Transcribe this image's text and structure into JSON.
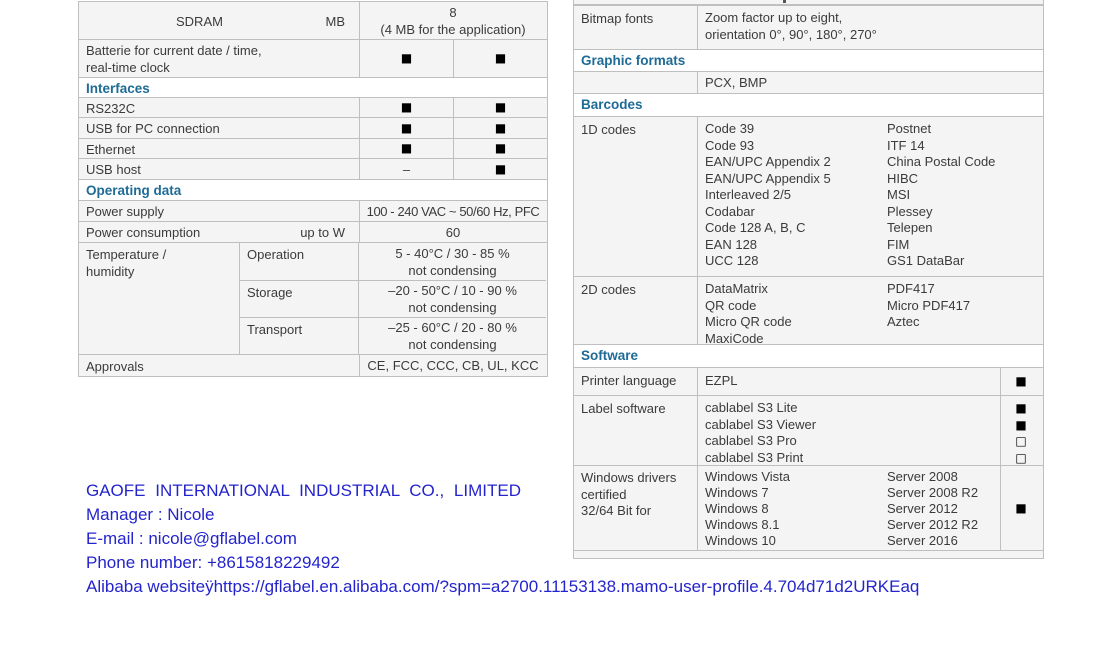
{
  "colors": {
    "section_header_blue": "#1e6b96",
    "contact_blue": "#2424cd",
    "table_row_bg": "#f4f4f5",
    "table_border": "#bfbfbf",
    "mark_black": "#000000"
  },
  "marks": {
    "filled": "■",
    "empty": "□",
    "dash": "–"
  },
  "spec_left": {
    "sdram_label": "SDRAM",
    "sdram_unit": "MB",
    "sdram_value_1": "8",
    "sdram_value_2": "(4 MB for the application)",
    "battery_label_1": "Batterie for current date / time,",
    "battery_label_2": "real-time clock",
    "battery_a": "■",
    "battery_b": "■",
    "interfaces_header": "Interfaces",
    "interfaces": [
      {
        "label": "RS232C",
        "a": "■",
        "b": "■"
      },
      {
        "label": "USB for PC connection",
        "a": "■",
        "b": "■"
      },
      {
        "label": "Ethernet",
        "a": "■",
        "b": "■"
      },
      {
        "label": "USB host",
        "a": "–",
        "b": "■"
      }
    ],
    "operating_header": "Operating data",
    "power_supply_label": "Power supply",
    "power_supply_value": "100 - 240 VAC ~ 50/60 Hz, PFC",
    "power_consumption_label": "Power consumption",
    "power_consumption_unit": "up to W",
    "power_consumption_value": "60",
    "temperature_label_1": "Temperature /",
    "temperature_label_2": "humidity",
    "temperature_rows": [
      {
        "mode": "Operation",
        "value_1": "5 - 40°C / 30 - 85 %",
        "value_2": "not condensing"
      },
      {
        "mode": "Storage",
        "value_1": "–20 - 50°C / 10 - 90 %",
        "value_2": "not condensing"
      },
      {
        "mode": "Transport",
        "value_1": "–25 - 60°C / 20 - 80 %",
        "value_2": "not condensing"
      }
    ],
    "approvals_label": "Approvals",
    "approvals_value": "CE, FCC, CCC, CB, UL, KCC"
  },
  "spec_right": {
    "bitmap_label": "Bitmap fonts",
    "bitmap_value_1": "Zoom factor up to eight,",
    "bitmap_value_2": "orientation 0°, 90°, 180°, 270°",
    "graphic_header": "Graphic formats",
    "graphic_value": "PCX, BMP",
    "barcodes_header": "Barcodes",
    "codes_1d_label": "1D codes",
    "codes_1d_col1": [
      "Code 39",
      "Code 93",
      "EAN/UPC Appendix 2",
      "EAN/UPC Appendix 5",
      "Interleaved 2/5",
      "Codabar",
      "Code 128 A, B, C",
      "EAN 128",
      "UCC 128"
    ],
    "codes_1d_col2": [
      "Postnet",
      "ITF 14",
      "China Postal Code",
      "HIBC",
      "MSI",
      "Plessey",
      "Telepen",
      "FIM",
      "GS1 DataBar"
    ],
    "codes_2d_label": "2D codes",
    "codes_2d_col1": [
      "DataMatrix",
      "QR code",
      "Micro QR code",
      "MaxiCode"
    ],
    "codes_2d_col2": [
      "PDF417",
      "Micro PDF417",
      "Aztec"
    ],
    "software_header": "Software",
    "printer_language_label": "Printer language",
    "printer_language_value": "EZPL",
    "printer_language_mark": "■",
    "label_software_label": "Label software",
    "label_software_items": [
      "cablabel S3 Lite",
      "cablabel S3 Viewer",
      "cablabel S3 Pro",
      "cablabel S3 Print"
    ],
    "label_software_marks": [
      "■",
      "■",
      "□",
      "□"
    ],
    "drivers_label_1": "Windows drivers",
    "drivers_label_2": "certified",
    "drivers_label_3": "32/64 Bit for",
    "drivers_col1": [
      "Windows Vista",
      "Windows 7",
      "Windows 8",
      "Windows 8.1",
      "Windows 10"
    ],
    "drivers_col2": [
      "Server 2008",
      "Server 2008 R2",
      "Server 2012",
      "Server 2012 R2",
      "Server 2016"
    ],
    "drivers_mark": "■"
  },
  "contact": {
    "company": "GAOFE INTERNATIONAL INDUSTRIAL CO., LIMITED",
    "manager": "Manager : Nicole",
    "email": "E-mail : nicole@gflabel.com",
    "phone": "Phone number: +8615818229492",
    "website": "Alibaba websiteÿhttps://gflabel.en.alibaba.com/?spm=a2700.11153138.mamo-user-profile.4.704d71d2URKEaq"
  }
}
